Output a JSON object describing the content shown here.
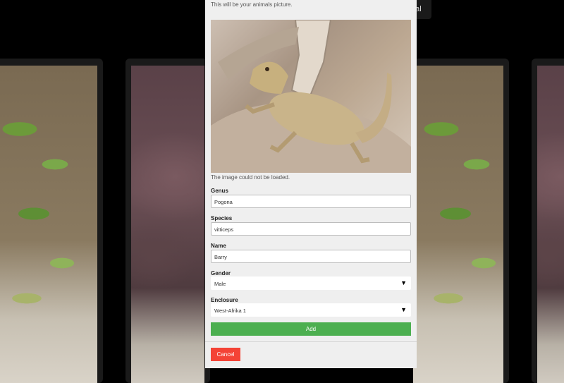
{
  "background": {
    "top_button_label": "mal"
  },
  "modal": {
    "picture_hint": "This will be your animals picture.",
    "image_error": "The image could not be loaded.",
    "fields": {
      "genus": {
        "label": "Genus",
        "value": "Pogona"
      },
      "species": {
        "label": "Species",
        "value": "vitticeps"
      },
      "name": {
        "label": "Name",
        "value": "Barry"
      },
      "gender": {
        "label": "Gender",
        "value": "Male"
      },
      "enclosure": {
        "label": "Enclosure",
        "value": "West-Afrika 1"
      }
    },
    "add_label": "Add",
    "cancel_label": "Cancel"
  },
  "colors": {
    "add": "#4caf50",
    "cancel": "#f44336",
    "modal_bg": "#efefef"
  }
}
